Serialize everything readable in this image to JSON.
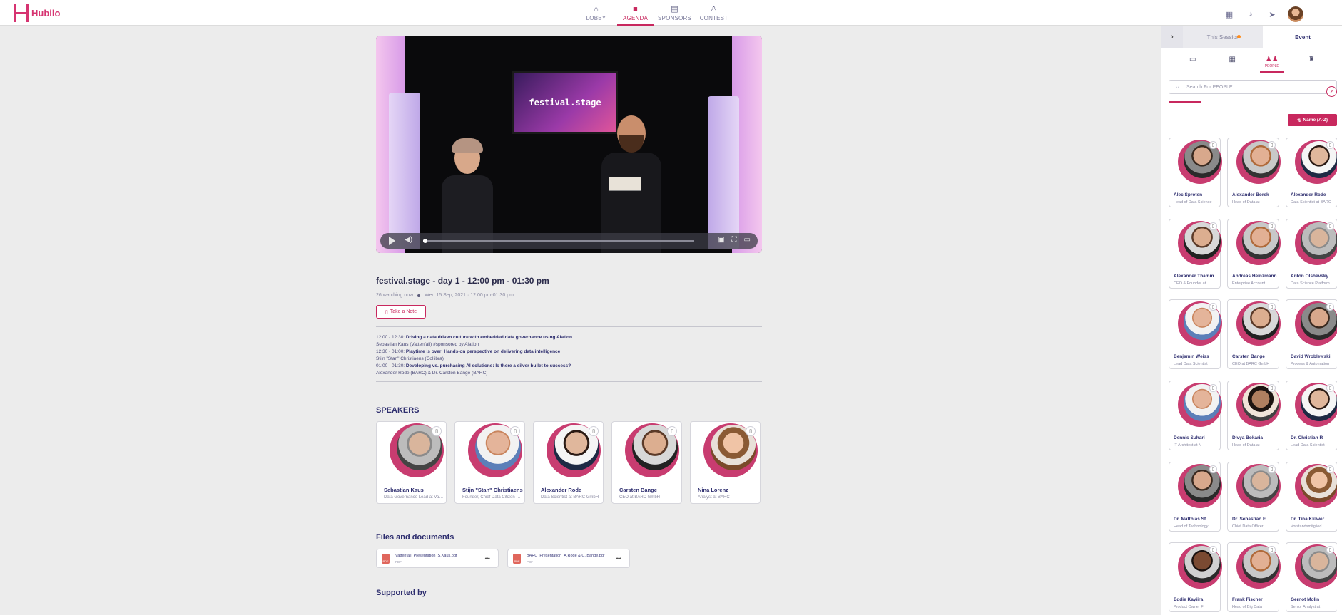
{
  "app": {
    "logo_text": "Hubilo",
    "brand_color": "#c8285e"
  },
  "nav": [
    {
      "label": "LOBBY",
      "icon": "home-icon"
    },
    {
      "label": "AGENDA",
      "icon": "video-icon",
      "active": true
    },
    {
      "label": "SPONSORS",
      "icon": "store-icon"
    },
    {
      "label": "CONTEST",
      "icon": "trophy-icon"
    }
  ],
  "video": {
    "screen_text": "festival.stage"
  },
  "session": {
    "title": "festival.stage - day 1 - 12:00 pm - 01:30 pm",
    "watching": "26 watching now",
    "datetime": "Wed 15 Sep, 2021 · 12:00 pm-01:30 pm",
    "note_label": "Take a Note"
  },
  "agenda": [
    {
      "time": "12:00 - 12:30: ",
      "talk": "Driving a data driven culture with embedded data governance using Alation",
      "speakers": "Sebastian Kaus (Vattenfall) #sponsored by Alation"
    },
    {
      "time": "12:30 - 01:00: ",
      "talk": "Playtime is over: Hands-on perspective on delivering data intelligence",
      "speakers": "Stijn \"Stan\" Christiaens (Collibra)"
    },
    {
      "time": "01:00 - 01:30: ",
      "talk": "Developing vs. purchasing AI solutions: Is there a silver bullet to success?",
      "speakers": "Alexander Rode (BARC) & Dr. Carsten Bange (BARC)"
    }
  ],
  "speakers_title": "SPEAKERS",
  "speakers": [
    {
      "name": "Sebastian Kaus",
      "role": "Data Governance Lead at Vattenfall"
    },
    {
      "name": "Stijn \"Stan\" Christiaens",
      "role": "Founder, Chief Data Citizen at Collibra"
    },
    {
      "name": "Alexander Rode",
      "role": "Data Scientist at BARC GmbH"
    },
    {
      "name": "Carsten Bange",
      "role": "CEO at BARC GmbH"
    },
    {
      "name": "Nina Lorenz",
      "role": "Analyst at BARC"
    }
  ],
  "files_title": "Files and documents",
  "files": [
    {
      "name": "Vattenfall_Presentation_S.Kaus.pdf",
      "type": "PDF"
    },
    {
      "name": "BARC_Presentation_A.Rode & C. Bange.pdf",
      "type": "PDF"
    }
  ],
  "supported_title": "Supported by",
  "panel": {
    "tab_session": "This Session",
    "tab_event": "Event",
    "people_label": "PEOPLE",
    "search_placeholder": "Search For PEOPLE",
    "sort_label": "Name (A-Z)",
    "people": [
      {
        "name": "Alec Sproten",
        "role": "Head of Data Science"
      },
      {
        "name": "Alexander Borek",
        "role": "Head of Data at"
      },
      {
        "name": "Alexander Rode",
        "role": "Data Scientist at BARC"
      },
      {
        "name": "Alexander Thamm",
        "role": "CEO & Founder at"
      },
      {
        "name": "Andreas Heinzmann",
        "role": "Enterprise Account"
      },
      {
        "name": "Anton Olshevsky",
        "role": "Data Science Platform"
      },
      {
        "name": "Benjamin Weiss",
        "role": "Lead Data Scientist"
      },
      {
        "name": "Carsten Bange",
        "role": "CEO at BARC GmbH"
      },
      {
        "name": "David Wroblewski",
        "role": "Process & Automation"
      },
      {
        "name": "Dennis Suhari",
        "role": "IT Architect at N"
      },
      {
        "name": "Divya Bokaria",
        "role": "Head of Data at"
      },
      {
        "name": "Dr. Christian R",
        "role": "Lead Data Scientist"
      },
      {
        "name": "Dr. Matthias St",
        "role": "Head of Technology"
      },
      {
        "name": "Dr. Sebastian F",
        "role": "Chief Data Officer"
      },
      {
        "name": "Dr. Tina Klüwer",
        "role": "Vorstandsmitglied"
      },
      {
        "name": "Eddie Kayiira",
        "role": "Product Owner F"
      },
      {
        "name": "Frank Fischer",
        "role": "Head of Big Data"
      },
      {
        "name": "Gernot Molin",
        "role": "Senior Analyst at"
      }
    ]
  }
}
